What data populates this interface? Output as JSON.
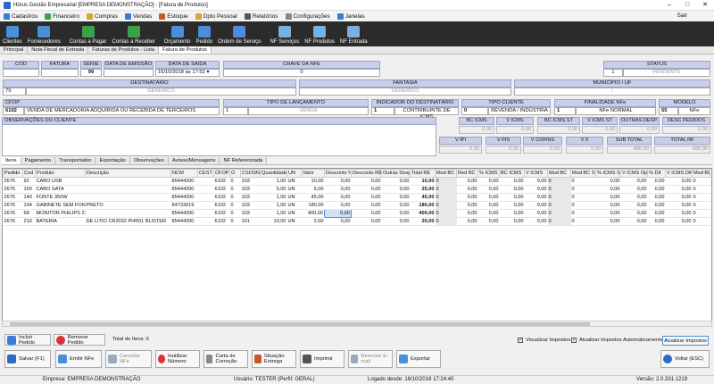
{
  "window": {
    "title": "Hórus Gestão Empresarial [EMPRESA DEMONSTRAÇÃO] - [Fatura de Produtos]"
  },
  "menu": {
    "items": [
      "Cadastros",
      "Financeiro",
      "Compras",
      "Vendas",
      "Estoque",
      "Dpto Pessoal",
      "Relatórios",
      "Configurações",
      "Janelas"
    ],
    "sair": "Sair"
  },
  "toolbar": {
    "items": [
      "Clientes",
      "Fornecedores",
      "Contas a Pagar",
      "Contas a Receber",
      "Orçamento",
      "Pedido",
      "Ordem de Serviço",
      "NF Serviços",
      "NF Produtos",
      "NF Entrada"
    ]
  },
  "tabs": [
    "Principal",
    "Nota Fiscal de Entrada",
    "Faturas de Produtos - Lista",
    "Fatura de Produtos"
  ],
  "header": {
    "cod_label": "COD",
    "fatura_label": "FATURA",
    "serie_label": "SÉRIE",
    "serie": "99",
    "emissao_label": "DATA DE EMISSÃO",
    "saida_label": "DATA DE SAÍDA",
    "saida": "16/10/2018 às 17:52",
    "chave_label": "CHAVE DA NFE",
    "chave": "0",
    "status_label": "STATUS",
    "status_num": "1",
    "status": "PENDENTE"
  },
  "dest": {
    "dest_label": "DESTINATÁRIO",
    "dest_code": "79",
    "dest_name": "GENÉRICO",
    "fantasia_label": "FANTASIA",
    "fantasia": "GENÉRICO",
    "mun_label": "MUNICÍPIO / UF",
    "mun": "/"
  },
  "cfop": {
    "cfop_label": "CFOP",
    "cfop_code": "6102",
    "cfop_desc": "VENDA DE MERCADORIA ADQUIRIDA OU RECEBIDA DE TERCEIROS",
    "tipo_lanc_label": "TIPO DE LANÇAMENTO",
    "tipo_lanc_num": "1",
    "tipo_lanc": "VENDA",
    "ind_dest_label": "INDICADOR DO DESTINATÁRIO",
    "ind_dest_num": "1",
    "ind_dest": "CONTRIBUINTE DE ICMS",
    "tipo_cli_label": "TIPO CLIENTE",
    "tipo_cli_num": "0",
    "tipo_cli": "REVENDA / INDÚSTRIA",
    "final_label": "FINALIDADE NFe",
    "final_num": "1",
    "final": "NFe NORMAL",
    "modelo_label": "MODELO",
    "modelo_num": "55",
    "modelo": "NFe"
  },
  "obs_label": "OBSERVAÇÕES DO CLIENTE",
  "totals_row1": [
    {
      "label": "BC ICMS",
      "value": "0,00"
    },
    {
      "label": "V ICMS",
      "value": "0,00"
    },
    {
      "label": "BC ICMS ST",
      "value": "0,00"
    },
    {
      "label": "V ICMS ST",
      "value": "0,00"
    },
    {
      "label": "OUTRAS DESP.",
      "value": "0,00"
    },
    {
      "label": "DESC PEDIDOS",
      "value": "0,00"
    }
  ],
  "totals_row2": [
    {
      "label": "V IPI",
      "value": "0,00"
    },
    {
      "label": "V PIS",
      "value": "0,00"
    },
    {
      "label": "V COFINS",
      "value": "0,00"
    },
    {
      "label": "V II",
      "value": "0,00"
    },
    {
      "label": "SUB TOTAL",
      "value": "680,00"
    },
    {
      "label": "TOTAL NF",
      "value": "680,00"
    }
  ],
  "subtabs": [
    "Itens",
    "Pagamento",
    "Transportador",
    "Exportação",
    "Observações",
    "Avisos/Mensagens",
    "NF Referenciada"
  ],
  "grid": {
    "columns": [
      "Pedido",
      "Cod",
      "Produto",
      "Descrição",
      "NCM",
      "CEST",
      "CFOP",
      "O",
      "CSOSN",
      "Quantidade",
      "UN",
      "Valor",
      "Desconto %",
      "Desconto R$",
      "Outras Desp.",
      "Total R$",
      "Mod BC",
      "Red BC",
      "% ICMS",
      "BC ICMS",
      "V ICMS",
      "Mod BC",
      "Mod BC ST",
      "% ICMS ST",
      "V ICMS Op",
      "% Dif",
      "V ICMS Dif",
      "Mod BC"
    ],
    "rows": [
      [
        "2676",
        "92",
        "CABO USB",
        "",
        "85444200",
        "",
        "6102",
        "0",
        "103",
        "1,00",
        "UN",
        "10,00",
        "0,00",
        "0,00",
        "0,00",
        "10,00",
        "0",
        "0,00",
        "0,00",
        "0,00",
        "0,00",
        "0",
        "0",
        "0,00",
        "0,00",
        "0,00",
        "0,00",
        "0"
      ],
      [
        "2676",
        "160",
        "CABO SATA",
        "",
        "85444200",
        "",
        "6102",
        "0",
        "103",
        "5,00",
        "UN",
        "5,00",
        "0,00",
        "0,00",
        "0,00",
        "25,00",
        "0",
        "0,00",
        "0,00",
        "0,00",
        "0,00",
        "0",
        "0",
        "0,00",
        "0,00",
        "0,00",
        "0,00",
        "0"
      ],
      [
        "2676",
        "140",
        "FONTE 350W",
        "",
        "85444200",
        "",
        "6102",
        "0",
        "103",
        "1,00",
        "UN",
        "45,00",
        "0,00",
        "0,00",
        "0,00",
        "45,00",
        "0",
        "0,00",
        "0,00",
        "0,00",
        "0,00",
        "0",
        "0",
        "0,00",
        "0,00",
        "0,00",
        "0,00",
        "0"
      ],
      [
        "2676",
        "104",
        "GABINETE SEM FONTE",
        "PRETO",
        "84733019",
        "",
        "6102",
        "0",
        "103",
        "1,00",
        "UN",
        "180,00",
        "0,00",
        "0,00",
        "0,00",
        "180,00",
        "0",
        "0,00",
        "0,00",
        "0,00",
        "0,00",
        "0",
        "0",
        "0,00",
        "0,00",
        "0,00",
        "0,00",
        "0"
      ],
      [
        "2676",
        "68",
        "MONITOR PHILIPS 21,5 LED",
        "",
        "85444200",
        "",
        "6102",
        "0",
        "103",
        "1,00",
        "UN",
        "400,00",
        "0,00",
        "0,00",
        "0,00",
        "400,00",
        "0",
        "0,00",
        "0,00",
        "0,00",
        "0,00",
        "0",
        "0",
        "0,00",
        "0,00",
        "0,00",
        "0,00",
        "0"
      ],
      [
        "2676",
        "210",
        "BATERIA",
        "DE LITIO CR2032 PI4501 BLISTER",
        "85444200",
        "",
        "6102",
        "0",
        "101",
        "10,00",
        "UN",
        "2,00",
        "0,00",
        "0,00",
        "0,00",
        "20,00",
        "0",
        "0,00",
        "0,00",
        "0,00",
        "0,00",
        "0",
        "0",
        "0,00",
        "0,00",
        "0,00",
        "0,00",
        "0"
      ]
    ]
  },
  "actions": {
    "incluir": "Incluir Pedido",
    "remover": "Remover Pedido",
    "total_itens": "Total de Itens: 6",
    "visualizar": "Visualizar Impostos",
    "atualizar_auto": "Atualizar Impostos Automaticamente",
    "atualizar": "Atualizar Impostos"
  },
  "bottom": {
    "salvar": "Salvar (F1)",
    "emitir": "Emitir NFe",
    "cancelar": "Cancelar NFe",
    "inutilizar": "Inutilizar Número",
    "carta": "Carta de Correção",
    "situacao": "Situação Entrega",
    "imprimir": "Imprimir",
    "reenviar": "Reenviar E-mail",
    "exportar": "Exportar",
    "voltar": "Voltar (ESC)"
  },
  "statusbar": {
    "empresa": "Empresa: EMPRESA DEMONSTRAÇÃO",
    "usuario": "Usuário: TESTER (Perfil: GERAL)",
    "logado": "Logado desde: 16/10/2018 17:24:40",
    "versao": "Versão: 2.0.331.1219"
  }
}
